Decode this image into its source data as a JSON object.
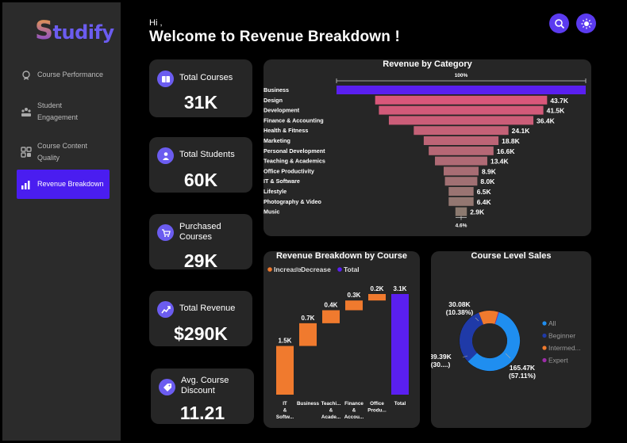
{
  "brand": {
    "logo_first": "S",
    "logo_rest": "tudify"
  },
  "sidebar": {
    "items": [
      {
        "label": "Course Performance"
      },
      {
        "label_line1": "Student",
        "label_line2": "Engagement"
      },
      {
        "label_line1": "Course Content",
        "label_line2": "Quality"
      },
      {
        "label": "Revenue Breakdown"
      }
    ]
  },
  "header": {
    "greeting": "Hi ,",
    "title": "Welcome to Revenue Breakdown !"
  },
  "kpis": [
    {
      "label": "Total Courses",
      "value": "31K"
    },
    {
      "label": "Total Students",
      "value": "60K"
    },
    {
      "label_line1": "Purchased",
      "label_line2": "Courses",
      "value": "29K"
    },
    {
      "label": "Total Revenue",
      "value": "$290K"
    },
    {
      "label_line1": "Avg. Course",
      "label_line2": "Discount",
      "value": "11.21"
    }
  ],
  "funnel": {
    "title": "Revenue by Category",
    "top_pct_label": "100%",
    "bottom_pct_label": "4.6%",
    "colors": {
      "top": "#5a1ff0",
      "high": "#d9577a",
      "low": "#8c7a70"
    }
  },
  "waterfall": {
    "title": "Revenue Breakdown by Course",
    "legend": [
      "Increase",
      "Decrease",
      "Total"
    ],
    "colors": {
      "increase": "#f07a2e",
      "decrease": "#777777",
      "total": "#5a1ff0"
    }
  },
  "donut": {
    "title": "Course Level Sales",
    "legend": [
      "All",
      "Beginner",
      "Intermed...",
      "Expert"
    ],
    "colors": {
      "all": "#1f8ef0",
      "beginner": "#1f3aa8",
      "intermediate": "#f07a2e",
      "expert": "#9c2ca8"
    },
    "labels": [
      {
        "a": "30.08K",
        "b": "(10.38%)"
      },
      {
        "a": "89.39K",
        "b": "(30....)"
      },
      {
        "a": "165.47K",
        "b": "(57.11%)"
      }
    ]
  },
  "chart_data": [
    {
      "type": "bar",
      "title": "Revenue by Category",
      "categories": [
        "Business",
        "Design",
        "Development",
        "Finance & Accounting",
        "Health & Fitness",
        "Marketing",
        "Personal Development",
        "Teaching & Academics",
        "Office Productivity",
        "IT & Software",
        "Lifestyle",
        "Photography & Video",
        "Music"
      ],
      "values": [
        null,
        43.7,
        41.5,
        36.4,
        24.1,
        18.8,
        16.6,
        13.4,
        8.9,
        8.0,
        6.5,
        6.4,
        2.9
      ],
      "value_labels": [
        "",
        "43.7K",
        "41.5K",
        "36.4K",
        "24.1K",
        "18.8K",
        "16.6K",
        "13.4K",
        "8.9K",
        "8.0K",
        "6.5K",
        "6.4K",
        "2.9K"
      ],
      "relative_widths": [
        1.0,
        0.69,
        0.66,
        0.58,
        0.38,
        0.3,
        0.26,
        0.21,
        0.14,
        0.13,
        0.1,
        0.1,
        0.046
      ]
    },
    {
      "type": "bar",
      "title": "Revenue Breakdown by Course",
      "categories": [
        "IT & Softw...",
        "Business",
        "Teachi... & Acade...",
        "Finance & Accou...",
        "Office Produ...",
        "Total"
      ],
      "values": [
        1.5,
        0.7,
        0.4,
        0.3,
        0.2,
        3.1
      ],
      "value_labels": [
        "1.5K",
        "0.7K",
        "0.4K",
        "0.3K",
        "0.2K",
        "3.1K"
      ],
      "kinds": [
        "increase",
        "increase",
        "increase",
        "increase",
        "increase",
        "total"
      ]
    },
    {
      "type": "pie",
      "title": "Course Level Sales",
      "categories": [
        "All",
        "Beginner",
        "Intermediate",
        "Expert"
      ],
      "values": [
        165.47,
        89.39,
        30.08,
        1.5
      ],
      "percents": [
        57.11,
        30.85,
        10.38,
        0.5
      ]
    }
  ]
}
